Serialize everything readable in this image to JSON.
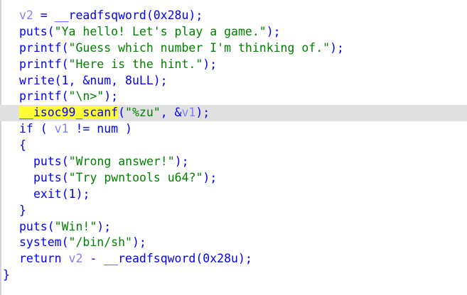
{
  "editor": {
    "lines": [
      {
        "indent": 1,
        "current": false,
        "tokens": [
          {
            "text": "v2",
            "cls": "var"
          },
          {
            "text": " = __readfsqword(0x28u);",
            "cls": "code"
          }
        ]
      },
      {
        "indent": 1,
        "current": false,
        "tokens": [
          {
            "text": "puts(",
            "cls": "code"
          },
          {
            "text": "\"Ya hello! Let's play a game.\"",
            "cls": "str"
          },
          {
            "text": ");",
            "cls": "code"
          }
        ]
      },
      {
        "indent": 1,
        "current": false,
        "tokens": [
          {
            "text": "printf(",
            "cls": "code"
          },
          {
            "text": "\"Guess which number I'm thinking of.\"",
            "cls": "str"
          },
          {
            "text": ");",
            "cls": "code"
          }
        ]
      },
      {
        "indent": 1,
        "current": false,
        "tokens": [
          {
            "text": "printf(",
            "cls": "code"
          },
          {
            "text": "\"Here is the hint.\"",
            "cls": "str"
          },
          {
            "text": ");",
            "cls": "code"
          }
        ]
      },
      {
        "indent": 1,
        "current": false,
        "tokens": [
          {
            "text": "write(1, &num, 8uLL);",
            "cls": "code"
          }
        ]
      },
      {
        "indent": 1,
        "current": false,
        "tokens": [
          {
            "text": "printf(",
            "cls": "code"
          },
          {
            "text": "\"\\n>\"",
            "cls": "str"
          },
          {
            "text": ");",
            "cls": "code"
          }
        ]
      },
      {
        "indent": 1,
        "current": true,
        "tokens": [
          {
            "text": "__isoc99_scanf",
            "cls": "hl"
          },
          {
            "text": "(",
            "cls": "code"
          },
          {
            "text": "\"%zu\"",
            "cls": "str"
          },
          {
            "text": ", &",
            "cls": "code"
          },
          {
            "text": "v1",
            "cls": "var"
          },
          {
            "text": ");",
            "cls": "code"
          }
        ]
      },
      {
        "indent": 1,
        "current": false,
        "tokens": [
          {
            "text": "if ( ",
            "cls": "code"
          },
          {
            "text": "v1",
            "cls": "var"
          },
          {
            "text": " != num )",
            "cls": "code"
          }
        ]
      },
      {
        "indent": 1,
        "current": false,
        "tokens": [
          {
            "text": "{",
            "cls": "code"
          }
        ]
      },
      {
        "indent": 2,
        "current": false,
        "tokens": [
          {
            "text": "puts(",
            "cls": "code"
          },
          {
            "text": "\"Wrong answer!\"",
            "cls": "str"
          },
          {
            "text": ");",
            "cls": "code"
          }
        ]
      },
      {
        "indent": 2,
        "current": false,
        "tokens": [
          {
            "text": "puts(",
            "cls": "code"
          },
          {
            "text": "\"Try pwntools u64?\"",
            "cls": "str"
          },
          {
            "text": ");",
            "cls": "code"
          }
        ]
      },
      {
        "indent": 2,
        "current": false,
        "tokens": [
          {
            "text": "exit(1);",
            "cls": "code"
          }
        ]
      },
      {
        "indent": 1,
        "current": false,
        "tokens": [
          {
            "text": "}",
            "cls": "code"
          }
        ]
      },
      {
        "indent": 1,
        "current": false,
        "tokens": [
          {
            "text": "puts(",
            "cls": "code"
          },
          {
            "text": "\"Win!\"",
            "cls": "str"
          },
          {
            "text": ");",
            "cls": "code"
          }
        ]
      },
      {
        "indent": 1,
        "current": false,
        "tokens": [
          {
            "text": "system(",
            "cls": "code"
          },
          {
            "text": "\"/bin/sh\"",
            "cls": "str"
          },
          {
            "text": ");",
            "cls": "code"
          }
        ]
      },
      {
        "indent": 1,
        "current": false,
        "tokens": [
          {
            "text": "return ",
            "cls": "code"
          },
          {
            "text": "v2",
            "cls": "var"
          },
          {
            "text": " - __readfsqword(0x28u);",
            "cls": "code"
          }
        ]
      },
      {
        "indent": 0,
        "current": false,
        "tokens": [
          {
            "text": "}",
            "cls": "code"
          }
        ]
      }
    ]
  }
}
